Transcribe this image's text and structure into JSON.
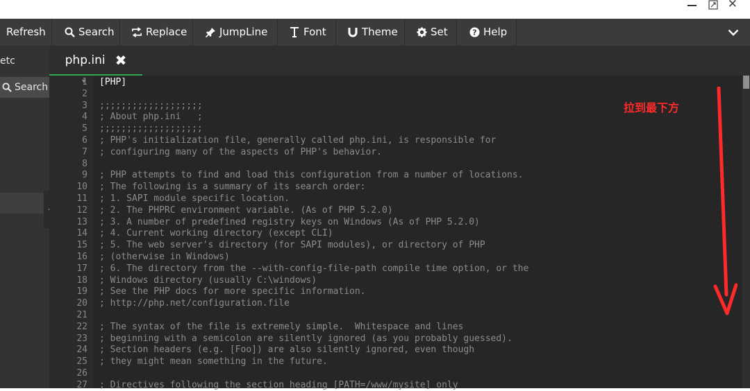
{
  "toolbar": {
    "buttons": [
      {
        "label": "Refresh",
        "icon": "refresh-icon"
      },
      {
        "label": "Search",
        "icon": "search-icon"
      },
      {
        "label": "Replace",
        "icon": "replace-icon"
      },
      {
        "label": "JumpLine",
        "icon": "pin-icon"
      },
      {
        "label": "Font",
        "icon": "font-icon"
      },
      {
        "label": "Theme",
        "icon": "theme-icon"
      },
      {
        "label": "Set",
        "icon": "gear-icon"
      },
      {
        "label": "Help",
        "icon": "help-icon"
      }
    ]
  },
  "sidebar": {
    "folder": "etc",
    "search_label": "Search"
  },
  "editor": {
    "tab_label": "php.ini",
    "lines": [
      {
        "n": "1",
        "text": "[PHP]"
      },
      {
        "n": "2",
        "text": ""
      },
      {
        "n": "3",
        "text": ";;;;;;;;;;;;;;;;;;;"
      },
      {
        "n": "4",
        "text": "; About php.ini   ;"
      },
      {
        "n": "5",
        "text": ";;;;;;;;;;;;;;;;;;;"
      },
      {
        "n": "6",
        "text": "; PHP's initialization file, generally called php.ini, is responsible for"
      },
      {
        "n": "7",
        "text": "; configuring many of the aspects of PHP's behavior."
      },
      {
        "n": "8",
        "text": ""
      },
      {
        "n": "9",
        "text": "; PHP attempts to find and load this configuration from a number of locations."
      },
      {
        "n": "10",
        "text": "; The following is a summary of its search order:"
      },
      {
        "n": "11",
        "text": "; 1. SAPI module specific location."
      },
      {
        "n": "12",
        "text": "; 2. The PHPRC environment variable. (As of PHP 5.2.0)"
      },
      {
        "n": "13",
        "text": "; 3. A number of predefined registry keys on Windows (As of PHP 5.2.0)"
      },
      {
        "n": "14",
        "text": "; 4. Current working directory (except CLI)"
      },
      {
        "n": "15",
        "text": "; 5. The web server's directory (for SAPI modules), or directory of PHP"
      },
      {
        "n": "16",
        "text": "; (otherwise in Windows)"
      },
      {
        "n": "17",
        "text": "; 6. The directory from the --with-config-file-path compile time option, or the"
      },
      {
        "n": "18",
        "text": "; Windows directory (usually C:\\windows)"
      },
      {
        "n": "19",
        "text": "; See the PHP docs for more specific information."
      },
      {
        "n": "20",
        "text": "; http://php.net/configuration.file"
      },
      {
        "n": "21",
        "text": ""
      },
      {
        "n": "22",
        "text": "; The syntax of the file is extremely simple.  Whitespace and lines"
      },
      {
        "n": "23",
        "text": "; beginning with a semicolon are silently ignored (as you probably guessed)."
      },
      {
        "n": "24",
        "text": "; Section headers (e.g. [Foo]) are also silently ignored, even though"
      },
      {
        "n": "25",
        "text": "; they might mean something in the future."
      },
      {
        "n": "26",
        "text": ""
      },
      {
        "n": "27",
        "text": "; Directives following the section heading [PATH=/www/mysite] only"
      }
    ]
  },
  "annotation": {
    "text": "拉到最下方",
    "color": "#ff2a2a"
  },
  "colors": {
    "accent_tab_underline": "#2fa84f",
    "toolbar_bg": "#3b3b3b",
    "editor_bg": "#262626"
  }
}
